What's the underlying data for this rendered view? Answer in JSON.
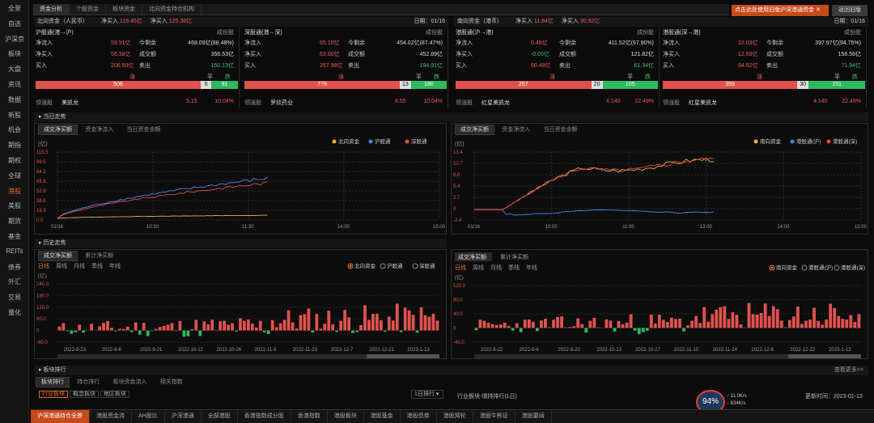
{
  "sidebar": [
    "全景",
    "自选",
    "沪深京",
    "板块",
    "大盘",
    "资讯",
    "数据",
    "新股",
    "机会",
    "期指",
    "期权",
    "全球",
    "港股",
    "美股",
    "期货",
    "基金",
    "REITs",
    "债券",
    "外汇",
    "交易",
    "量化"
  ],
  "top_tabs": [
    "资金分析",
    "个股资金",
    "板块资金",
    "北向资金持仓机构"
  ],
  "notice": "点击此处使用旧版沪深港通资金",
  "back_label": "返回旧版",
  "north": {
    "title": "北向资金（人民币）",
    "net_label": "净买入",
    "net": "119.45亿",
    "today_label": "净买入",
    "today": "125.38亿",
    "date": "日期：01/16"
  },
  "south": {
    "title": "南向资金（港币）",
    "net_label": "净买入",
    "net": "11.84亿",
    "today_label": "净买入",
    "today": "30.92亿",
    "date": "日期：01/16"
  },
  "cards": [
    {
      "title": "沪股通(港→沪)",
      "unit": "成份股",
      "net_in": "59.91亿",
      "remain_label": "今剩余",
      "remain": "468.09亿(88.48%)",
      "net_buy": "56.38亿",
      "vol": "356.53亿",
      "buy": "206.50亿",
      "sell": "150.13亿",
      "up": "506",
      "flat": "6",
      "down": "81",
      "leader_label": "领涨股",
      "leader": "美凯龙",
      "price": "5.15",
      "pct": "10.04%"
    },
    {
      "title": "深股通(港→深)",
      "unit": "成份股",
      "net_in": "65.10亿",
      "remain_label": "今剩余",
      "remain": "454.02亿(87.47%)",
      "net_buy": "63.00亿",
      "vol": "452.89亿",
      "buy": "257.98亿",
      "sell": "194.91亿",
      "up": "779",
      "flat": "13",
      "down": "180",
      "leader_label": "领涨股",
      "leader": "罗欣药业",
      "price": "8.55",
      "pct": "10.04%"
    },
    {
      "title": "港股通(沪→港)",
      "unit": "成份股",
      "net_in": "0.48亿",
      "remain_label": "今剩余",
      "remain": "411.52亿(97.90%)",
      "net_buy": "-0.05亿",
      "vol": "121.82亿",
      "buy": "60.49亿",
      "sell": "61.34亿",
      "up": "257",
      "flat": "20",
      "down": "105",
      "leader_label": "领涨股",
      "leader": "红星美凯龙",
      "price": "4.140",
      "pct": "22.49%"
    },
    {
      "title": "港股通(深→港)",
      "unit": "成份股",
      "net_in": "22.03亿",
      "remain_label": "今剩余",
      "remain": "397.97亿(94.75%)",
      "net_buy": "12.69亿",
      "vol": "156.56亿",
      "buy": "84.62亿",
      "sell": "71.94亿",
      "up": "359",
      "flat": "30",
      "down": "151",
      "leader_label": "领涨股",
      "leader": "红星美凯龙",
      "price": "4.140",
      "pct": "22.49%"
    }
  ],
  "labels": {
    "net_in": "净流入",
    "net_buy": "净买入",
    "vol": "成交额",
    "buy": "买入",
    "sell": "卖出",
    "up": "涨",
    "flat": "平",
    "down": "跌"
  },
  "section_today": "当日走势",
  "section_history": "历史走势",
  "section_sector": "板块排行",
  "subtabs_today": [
    "成交净买额",
    "资金净流入",
    "当日资金余额"
  ],
  "subtabs_hist": [
    "成交净买额",
    "累计净买额"
  ],
  "periods": [
    "日线",
    "周线",
    "月线",
    "季线",
    "年线"
  ],
  "chart_data": [
    {
      "type": "line",
      "unit": "(亿)",
      "x_ticks": [
        "01/16",
        "10:30",
        "11:30",
        "14:00",
        "15:00"
      ],
      "y_ticks": [
        "115.5",
        "99.5",
        "84.2",
        "68.6",
        "52.8",
        "38.8",
        "19.9",
        "0.0"
      ],
      "series": [
        {
          "name": "北向资金",
          "color": "#e6b23a"
        },
        {
          "name": "沪股通",
          "color": "#4a86e8"
        },
        {
          "name": "深股通",
          "color": "#e84a4a"
        }
      ]
    },
    {
      "type": "line",
      "unit": "(亿)",
      "x_ticks": [
        "01/16",
        "10:00",
        "11:00",
        "13:00",
        "14:00",
        "15:00"
      ],
      "y_ticks": [
        "13.4",
        "10.7",
        "8.0",
        "5.4",
        "2.7",
        "0",
        "-2.4"
      ],
      "series": [
        {
          "name": "南向资金",
          "color": "#e6b23a"
        },
        {
          "name": "港股通(沪)",
          "color": "#4a86e8"
        },
        {
          "name": "港股通(深)",
          "color": "#e84a4a"
        }
      ]
    },
    {
      "type": "bar",
      "unit": "(亿)",
      "y_ticks": [
        "240.0",
        "180.0",
        "120.0",
        "60.0",
        "0",
        "-60.0"
      ],
      "x_ticks": [
        "2022-8-23",
        "2022-9-6",
        "2022-9-21",
        "2022-10-12",
        "2022-10-26",
        "2022-11-9",
        "2022-11-23",
        "2022-12-7",
        "2022-12-21",
        "2023-1-13"
      ],
      "radios": [
        "北向资金",
        "沪股通",
        "深股通"
      ]
    },
    {
      "type": "bar",
      "unit": "(亿)",
      "y_ticks": [
        "120.0",
        "80.0",
        "40.0",
        "0",
        "-40.0"
      ],
      "x_ticks": [
        "2022-8-22",
        "2022-9-6",
        "2022-9-20",
        "2022-10-13",
        "2022-10-27",
        "2022-11-10",
        "2022-11-24",
        "2022-12-8",
        "2022-12-22",
        "2023-1-13"
      ],
      "radios": [
        "南向资金",
        "港股通(沪)",
        "港股通(深)"
      ]
    }
  ],
  "sector": {
    "tabs": [
      "板块排行",
      "持仓排行",
      "板块资金流入",
      "相关指数"
    ],
    "chips": [
      "行业板块",
      "概念板块",
      "地区板块"
    ],
    "select": "1日排行",
    "title": "行业板块-增持排行(1日)",
    "update_label": "更新时间：",
    "update": "2023-01-13",
    "more": "查看更多>>"
  },
  "bottom_tabs": [
    "沪深港通持仓全景",
    "港股资金流",
    "AH股比",
    "沪深港通",
    "全部港股",
    "香港指数成分股",
    "香港指数",
    "港股板块",
    "港股基金",
    "港股债券",
    "港股窝轮",
    "港股牛熊证",
    "港股要闻"
  ],
  "widget": {
    "pct": "94%",
    "up": "11.0K/s",
    "down": "834K/s"
  }
}
